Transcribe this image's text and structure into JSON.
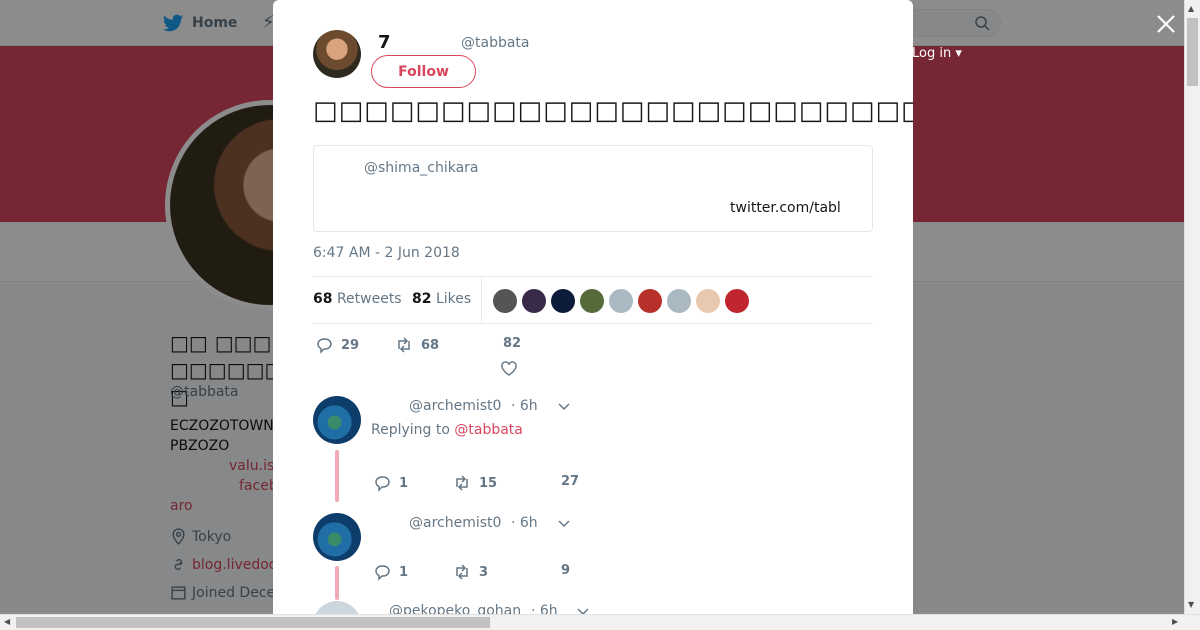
{
  "nav": {
    "home_label": "Home",
    "login_label": "Log in ▾"
  },
  "profile": {
    "name": "□□ □□□□□□□□□□",
    "handle": "@tabbata",
    "bio_line1": "ECZOZOTOWN",
    "bio_line2": "PBZOZO",
    "bio_link1": "valu.is",
    "bio_link2": "faceb",
    "bio_link3": "aro",
    "location": "Tokyo",
    "website": "blog.livedoo",
    "joined": "Joined Dece"
  },
  "tweet": {
    "name": "7",
    "handle": "@tabbata",
    "follow_label": "Follow",
    "text": "□□□□□□□□□□□□□□□□□□□□□□□□□□□□□□□□□□□□□□□□□",
    "quote_handle": "@shima_chikara",
    "quote_link": "twitter.com/tabl",
    "timestamp": "6:47 AM - 2 Jun 2018",
    "retweets_count": "68",
    "retweets_label": "Retweets",
    "likes_count": "82",
    "likes_label": "Likes",
    "reply_count": "29",
    "retweet_count": "68",
    "like_count": "82",
    "liker_colors": [
      "#555555",
      "#3a2a4a",
      "#0d1b3a",
      "#556b3a",
      "#aab8c2",
      "#b8302a",
      "#aab8c2",
      "#e8c9b0",
      "#c0262d"
    ]
  },
  "replies": [
    {
      "handle": "@archemist0",
      "time": "· 6h",
      "replying_prefix": "Replying to",
      "replying_to": "@tabbata",
      "replies": "1",
      "retweets": "15",
      "likes": "27"
    },
    {
      "handle": "@archemist0",
      "time": "· 6h",
      "replies": "1",
      "retweets": "3",
      "likes": "9"
    },
    {
      "handle": "@pekopeko_gohan",
      "time": "· 6h"
    }
  ]
}
